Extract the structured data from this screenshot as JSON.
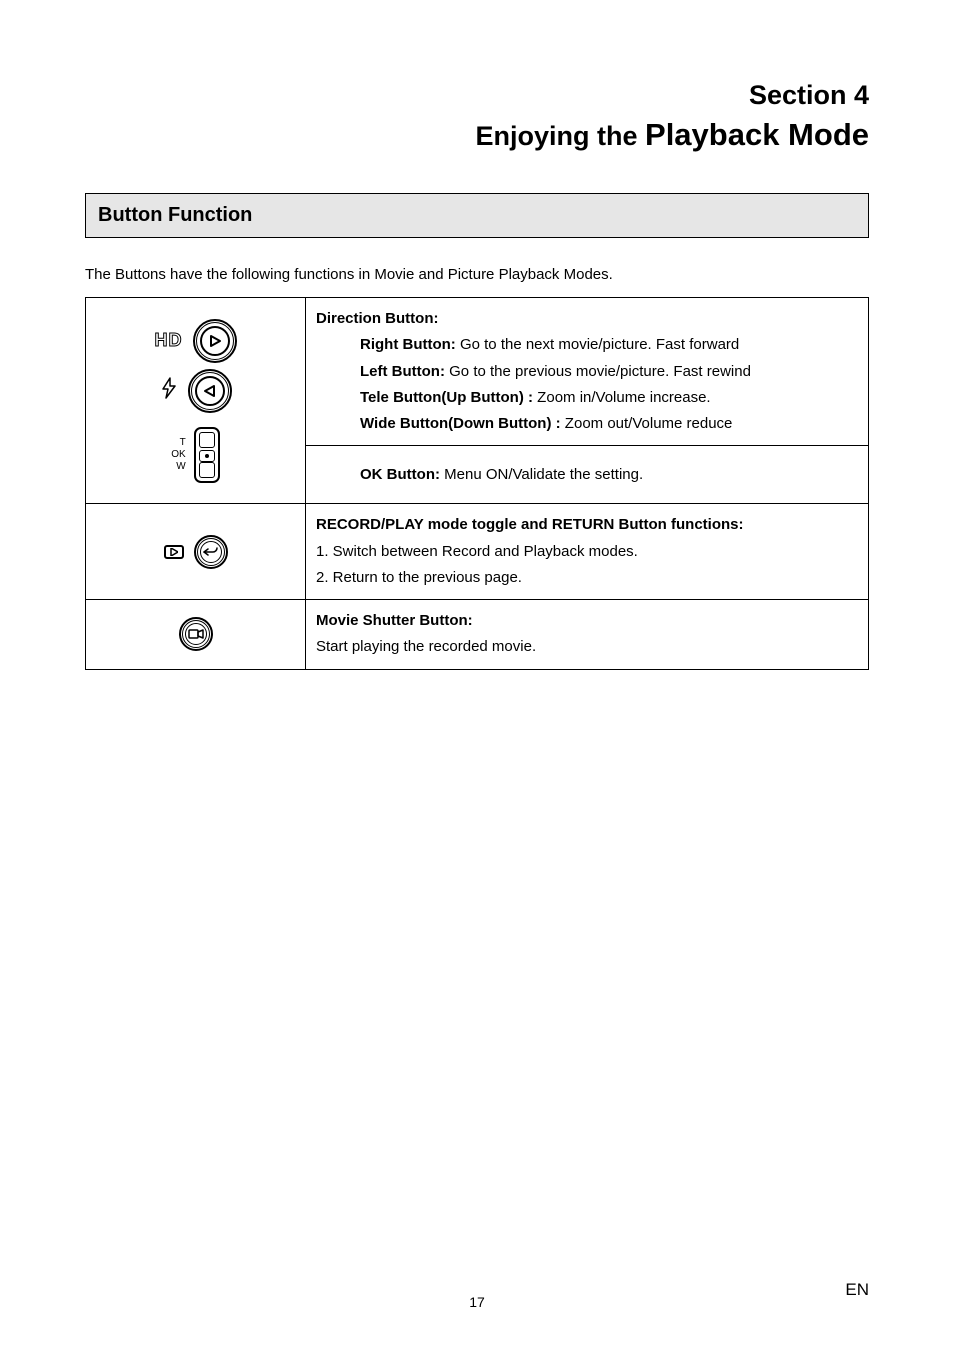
{
  "section": {
    "line1": "Section 4",
    "line2_prefix": "Enjoying the ",
    "line2_big": "Playback Mode"
  },
  "heading": "Button Function",
  "intro": "The Buttons have the following functions in Movie and Picture Playback Modes.",
  "row1": {
    "label_hd": "HD",
    "title": "Direction Button:",
    "right_b": "Right Button:",
    "right_t": " Go to the next movie/picture. Fast forward",
    "left_b": "Left Button:",
    "left_t": " Go to the previous movie/picture. Fast rewind",
    "tele_b": "Tele Button(Up Button) :",
    "tele_t": " Zoom in/Volume increase.",
    "wide_b": "Wide Button(Down Button) :",
    "wide_t": " Zoom out/Volume reduce",
    "rocker": {
      "t": "T",
      "ok": "OK",
      "w": "W"
    }
  },
  "row1b": {
    "ok_b": "OK Button:",
    "ok_t": " Menu ON/Validate the  setting."
  },
  "row2": {
    "title": "RECORD/PLAY mode toggle and RETURN Button functions:",
    "l1": "1. Switch between Record and Playback modes.",
    "l2": "2. Return to the previous page."
  },
  "row3": {
    "title": "Movie Shutter Button:",
    "l1": "Start playing the recorded movie."
  },
  "footer": {
    "page": "17",
    "lang": "EN"
  }
}
